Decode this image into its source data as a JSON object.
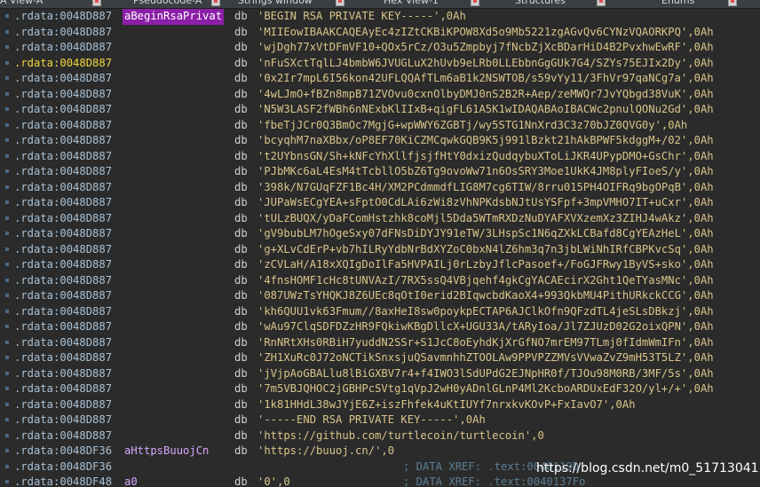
{
  "tabs": [
    {
      "label": "A View-A"
    },
    {
      "label": "Pseudocode-A"
    },
    {
      "label": "Strings window"
    },
    {
      "label": "Hex View-1"
    },
    {
      "label": "Structures"
    },
    {
      "label": "Enums"
    }
  ],
  "lines": [
    {
      "addr": ".rdata:0048D887",
      "label": "aBeginRsaPrivat",
      "instr": "db",
      "operand": "'BEGIN RSA PRIVATE KEY-----',0Ah"
    },
    {
      "addr": ".rdata:0048D887",
      "label": "",
      "instr": "db",
      "operand": "'MIIEowIBAAKCAQEAyEc4zIZtCKBiKPOW8Xd5o9Mb5221zgAGvQv6CYNzVQAORKPQ',0Ah"
    },
    {
      "addr": ".rdata:0048D887",
      "label": "",
      "instr": "db",
      "operand": "'wjDgh77xVtDFmVF10+QOx5rCz/O3u5Zmpbyj7fNcbZjXcBDarHiD4B2PvxhwEwRF',0Ah"
    },
    {
      "addr": ".rdata:0048D887",
      "label": "",
      "instr": "db",
      "operand": "'nFuSXctTqlLJ4bmbW6JVUGLuX2hUvb9eLRb0LLEbbnGgGUk7G4/SZYs75EJIx2Dy',0Ah"
    },
    {
      "addr": ".rdata:0048D887",
      "label": "",
      "instr": "db",
      "operand": "'0x2Ir7mpL6I56kon42UFLQQAfTLm6aB1k2NSWTOB/s59vYy11/3FhVr97qaNCg7a',0Ah"
    },
    {
      "addr": ".rdata:0048D887",
      "label": "",
      "instr": "db",
      "operand": "'4wLJmO+fBZn8mpB71ZVOvu0cxnOlbyDMJ0nS2B2R+Aep/zeMWQr7JvYQbgd38VuK',0Ah"
    },
    {
      "addr": ".rdata:0048D887",
      "label": "",
      "instr": "db",
      "operand": "'N5W3LASF2fWBh6nNExbKlIIxB+qigFL61A5K1wIDAQABAoIBACWc2pnulQONu2Gd',0Ah"
    },
    {
      "addr": ".rdata:0048D887",
      "label": "",
      "instr": "db",
      "operand": "'fbeTjJCr0Q3BmOc7MgjG+wpWWY6ZGBTj/wy5STG1NnXrd3C3z70bJZ0QVG0y',0Ah"
    },
    {
      "addr": ".rdata:0048D887",
      "label": "",
      "instr": "db",
      "operand": "'bcyqhM7naXBbx/oP8EF70KiCZMCqwkGQB9K5j991lBzkt21hAkBPWF5kdggM+/02',0Ah"
    },
    {
      "addr": ".rdata:0048D887",
      "label": "",
      "instr": "db",
      "operand": "'t2UYbnsGN/Sh+kNFcYhXllfjsjfHtY0dxizQudqybuXToLiJKR4UPypDMO+GsChr',0Ah"
    },
    {
      "addr": ".rdata:0048D887",
      "label": "",
      "instr": "db",
      "operand": "'PJbMKc6aL4EsM4tTcbllO5bZ6Tg9ovoWw71n6OsSRY3Moe1UkK4JM8plyFIoeS/y',0Ah"
    },
    {
      "addr": ".rdata:0048D887",
      "label": "",
      "instr": "db",
      "operand": "'398k/N7GUqFZF1Bc4H/XM2PCdmmdfLIG8M7cg6TIW/8rru015PH4OIFRq9bgOPqB',0Ah"
    },
    {
      "addr": ".rdata:0048D887",
      "label": "",
      "instr": "db",
      "operand": "'JUPaWsECgYEA+sFptO0CdLAi6zWi8zVhNPKdsbNJtUsYSFpf+3mpVMHO7IT+uCxr',0Ah"
    },
    {
      "addr": ".rdata:0048D887",
      "label": "",
      "instr": "db",
      "operand": "'tULzBUQX/yDaFComHstzhk8coMjl5Dda5WTmRXDzNuDYAFXVXzemXz3ZIHJ4wAkz',0Ah"
    },
    {
      "addr": ".rdata:0048D887",
      "label": "",
      "instr": "db",
      "operand": "'gV9bubLM7hOgeSxy07dFNsDiDYJY91eTW/3LHspSc1N6qZXkLCBafd8CgYEAzHeL',0Ah"
    },
    {
      "addr": ".rdata:0048D887",
      "label": "",
      "instr": "db",
      "operand": "'g+XLvCdErP+vb7hILRyYdbNrBdXYZoC0bxN4lZ6hm3q7n3jbLWiNhIRfCBPKvcSq',0Ah"
    },
    {
      "addr": ".rdata:0048D887",
      "label": "",
      "instr": "db",
      "operand": "'zCVLaH/A18xXQIgDoIlFa5HVPAILj0rLzbyJflcPasoef+/FoGJFRwy1ByVS+sko',0Ah"
    },
    {
      "addr": ".rdata:0048D887",
      "label": "",
      "instr": "db",
      "operand": "'4fnsHOMF1cHc8tUNVAzI/7RX5ssQ4VBjqehf4gkCgYACAEcirX2Ght1QeTYasMNc',0Ah"
    },
    {
      "addr": ".rdata:0048D887",
      "label": "",
      "instr": "db",
      "operand": "'087UWzTsYHQKJ8Z6UEc8qOtI0erid2BIqwcbdKaoX4+993QkbMU4PithURkckCCG',0Ah"
    },
    {
      "addr": ".rdata:0048D887",
      "label": "",
      "instr": "db",
      "operand": "'kh6QUU1vk63Fmum//8axHeI8sw0poykpECTAP6AJClkOfn9QFzdTL4jeSLsDBkzj',0Ah"
    },
    {
      "addr": ".rdata:0048D887",
      "label": "",
      "instr": "db",
      "operand": "'wAu97ClqSDFDZzHR9FQkiwKBgDllcX+UGU33A/tARyIoa/Jl7ZJUzD02G2oixQPN',0Ah"
    },
    {
      "addr": ".rdata:0048D887",
      "label": "",
      "instr": "db",
      "operand": "'RnNRtXHs0RBiH7yuddN2SSr+S1JcC8oEyhdKjXrGfNO7mrEM97TLmj0fIdmWmIFn',0Ah"
    },
    {
      "addr": ".rdata:0048D887",
      "label": "",
      "instr": "db",
      "operand": "'ZH1XuRc0J72oNCTikSnxsjuQSavmnhhZTOOLAw9PPVPZZMVsVVwaZvZ9mH53T5LZ',0Ah"
    },
    {
      "addr": ".rdata:0048D887",
      "label": "",
      "instr": "db",
      "operand": "'jVjpAoGBALlu8lBiGXBV7r4+f4IWO3lSdUPdG2EJNpHR0f/TJOu98M0RB/3MF/5s',0Ah"
    },
    {
      "addr": ".rdata:0048D887",
      "label": "",
      "instr": "db",
      "operand": "'7m5VBJQHOC2jGBHPcSVtg1qVpJ2wH0yADnlGLnP4Ml2KcboARDUxEdF32O/yl+/+',0Ah"
    },
    {
      "addr": ".rdata:0048D887",
      "label": "",
      "instr": "db",
      "operand": "'1k81HHdL38wJYjE6Z+iszFhfek4uKtIUYf7nrxkvKOvP+FxIavO7',0Ah"
    },
    {
      "addr": ".rdata:0048D887",
      "label": "",
      "instr": "db",
      "operand": "'-----END RSA PRIVATE KEY-----',0Ah"
    },
    {
      "addr": ".rdata:0048D887",
      "label": "",
      "instr": "db",
      "operand": "'https://github.com/turtlecoin/turtlecoin',0"
    },
    {
      "addr": ".rdata:0048DF36",
      "label": "aHttpsBuuojCn",
      "instr": "db",
      "operand": "'https://buuoj.cn/',0"
    },
    {
      "addr": ".rdata:0048DF36",
      "label": "",
      "instr": "",
      "operand": "",
      "comment": "; DATA XREF: .text:0040119D"
    },
    {
      "addr": ".rdata:0048DF48",
      "label": "a0",
      "instr": "db",
      "operand": "'0',0",
      "comment": "; DATA XREF: .text:0040137Fo"
    }
  ],
  "highlighted_row": 3,
  "selected_label_row": 0,
  "watermark": "https://blog.csdn.net/m0_51713041",
  "colors": {
    "background": "#2b2b2b",
    "address": "#a8c0d4",
    "address_highlight": "#f0d83c",
    "label": "#d6a6ff",
    "label_selected_bg": "#8b1fa8",
    "operand": "#d9c48a",
    "comment": "#5c7f94"
  }
}
